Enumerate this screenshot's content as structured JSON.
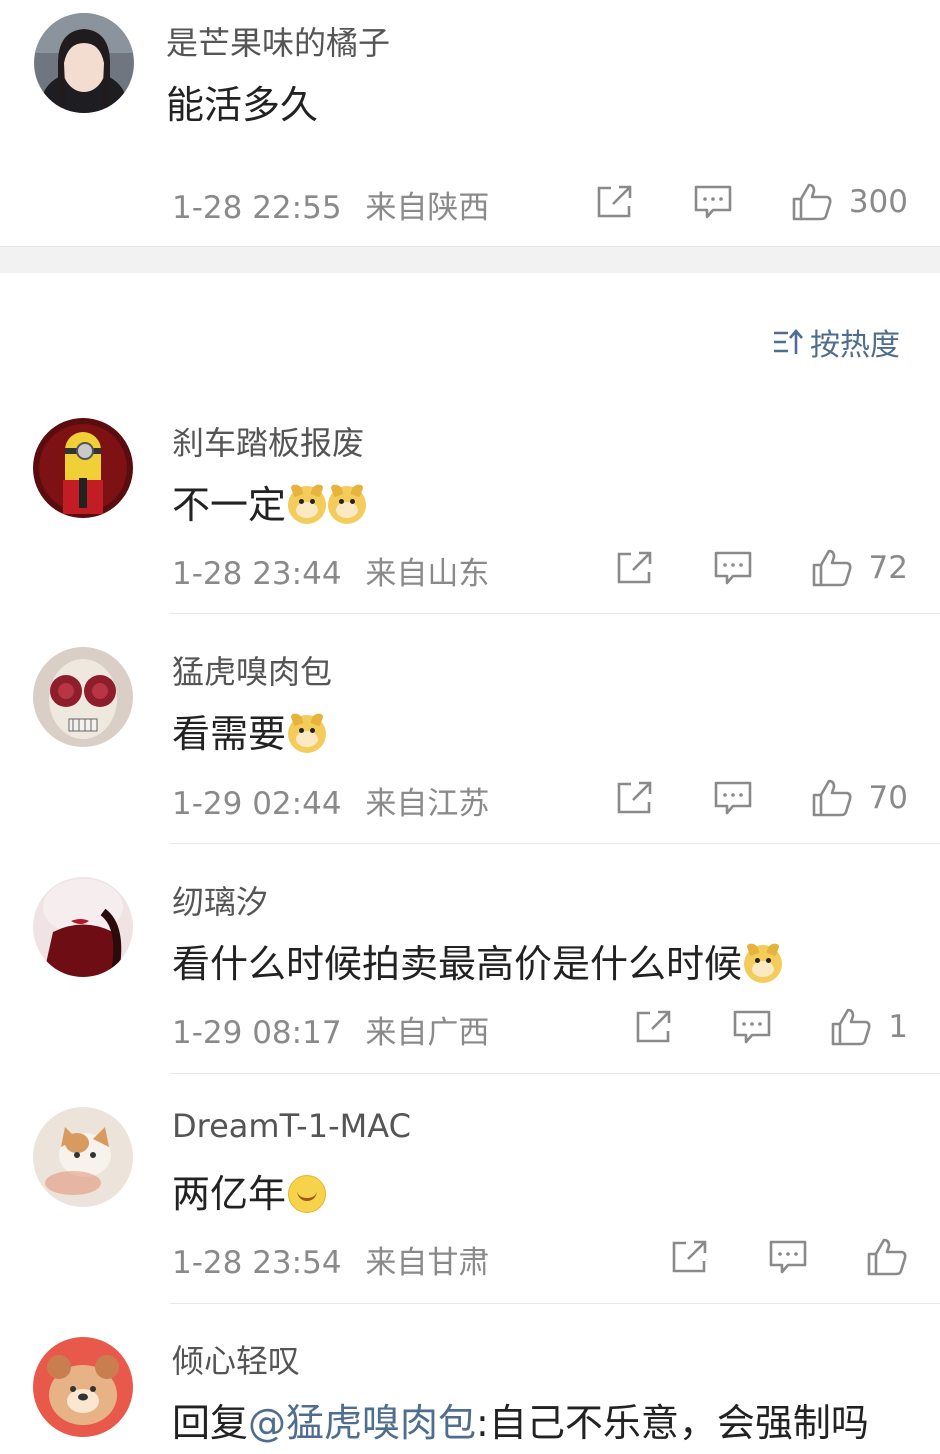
{
  "top_comment": {
    "username": "是芒果味的橘子",
    "content": "能活多久",
    "time": "1-28 22:55",
    "location": "来自陕西",
    "likes": "300"
  },
  "sort": {
    "label": "按热度"
  },
  "comments": [
    {
      "username": "刹车踏板报废",
      "content": "不一定",
      "emojis": [
        "doge",
        "doge"
      ],
      "time": "1-28 23:44",
      "location": "来自山东",
      "likes": "72"
    },
    {
      "username": "猛虎嗅肉包",
      "content": "看需要",
      "emojis": [
        "doge"
      ],
      "time": "1-29 02:44",
      "location": "来自江苏",
      "likes": "70"
    },
    {
      "username": "纫璃汐",
      "content": "看什么时候拍卖最高价是什么时候",
      "emojis": [
        "doge"
      ],
      "time": "1-29 08:17",
      "location": "来自广西",
      "likes": "1"
    },
    {
      "username": "DreamT-1-MAC",
      "content": "两亿年",
      "emojis": [
        "smile"
      ],
      "time": "1-28 23:54",
      "location": "来自甘肃",
      "likes": ""
    },
    {
      "username": "倾心轻叹",
      "reply_prefix": "回复",
      "mention": "@猛虎嗅肉包",
      "content": ":自己不乐意，会强制吗"
    }
  ],
  "icons": {
    "share": "share-icon",
    "comment": "comment-icon",
    "like": "like-icon",
    "sort": "sort-icon"
  },
  "colors": {
    "link": "#4f6d8f",
    "meta": "#8a8a8a",
    "divider": "#f2f2f2"
  }
}
